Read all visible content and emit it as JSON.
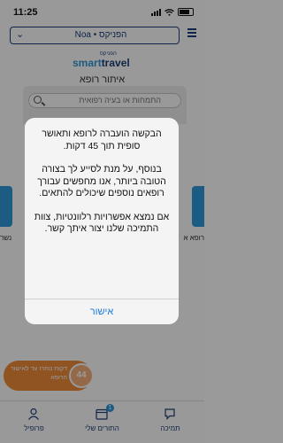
{
  "status_bar": {
    "time": "11:25"
  },
  "header": {
    "selector_value": "הפניקס • Noa",
    "title": "איתור רופא",
    "logo": {
      "sub": "הפניקס",
      "smart": "smart",
      "travel": "travel"
    }
  },
  "search": {
    "placeholder": "התמחות או בעיה רפואית"
  },
  "side_cards": {
    "left_label": "נשר",
    "right_label": "רופא א"
  },
  "wait": {
    "minutes": "44",
    "text": "דקות נותרו עד לאישור הרופא"
  },
  "tabs": [
    {
      "label": "פרופיל",
      "icon": "person-icon"
    },
    {
      "label": "התורים שלי",
      "icon": "calendar-icon",
      "badge": "1"
    },
    {
      "label": "תמיכה",
      "icon": "chat-icon"
    }
  ],
  "dialog": {
    "paragraph_1": "הבקשה הועברה לרופא ותאושר סופית תוך 45 דקות.",
    "paragraph_2": "בנוסף, על מנת לסייע לך בצורה הטובה ביותר, אנו מחפשים עבורך רופאים נוספים שיכולים להתאים.",
    "paragraph_3": "אם נמצא אפשרויות רלוונטיות, צוות התמיכה שלנו יצור איתך קשר.",
    "confirm_label": "אישור"
  },
  "colors": {
    "brand_navy": "#1c3f78",
    "brand_blue": "#2f9ad9",
    "accent_orange": "#f08a3a",
    "link_blue": "#1a7ad9"
  }
}
